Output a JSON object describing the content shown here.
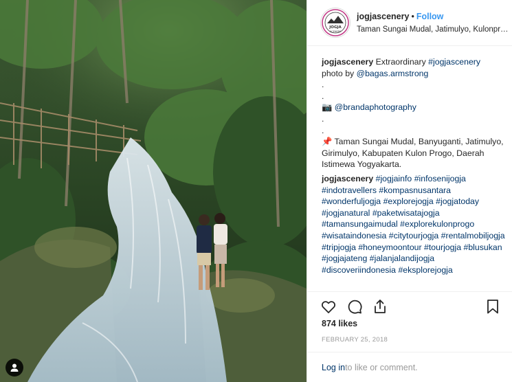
{
  "header": {
    "avatar_line1": "JOGJA",
    "avatar_line2": "SCENERY",
    "username": "jogjascenery",
    "separator": "•",
    "follow_label": "Follow",
    "location": "Taman Sungai Mudal, Jatimulyo, Kulonprogo"
  },
  "caption": {
    "username": "jogjascenery",
    "text_start": "Extraordinary ",
    "hashtag1": "#jogjascenery",
    "text_photo_by": "photo by ",
    "photo_mention": "@bagas.armstrong",
    "dot1": ".",
    "dot2": ".",
    "camera_icon": "📷",
    "camera_mention": "@brandaphotography",
    "dot3": ".",
    "dot4": ".",
    "pin_icon": "📌",
    "address": "Taman Sungai Mudal, Banyuganti, Jatimulyo, Girimulyo, Kabupaten Kulon Progo, Daerah Istimewa Yogyakarta."
  },
  "comment": {
    "username": "jogjascenery",
    "hashtags": [
      "#jogjainfo",
      "#infosenijogja",
      "#indotravellers",
      "#kompasnusantara",
      "#wonderfuljogja",
      "#explorejogja",
      "#jogjatoday",
      "#jogjanatural",
      "#paketwisatajogja",
      "#tamansungaimudal",
      "#explorekulonprogo",
      "#wisataindonesia",
      "#citytourjogja",
      "#rentalmobiljogja",
      "#tripjogja",
      "#honeymoontour",
      "#tourjogja",
      "#blusukan",
      "#jogjajateng",
      "#jalanjalandijogja",
      "#discoveriindonesia",
      "#eksplorejogja"
    ]
  },
  "actions": {
    "icons": [
      "heart-icon",
      "comment-icon",
      "share-icon",
      "bookmark-icon"
    ]
  },
  "likes_text": "874 likes",
  "date_text": "FEBRUARY 25, 2018",
  "footer": {
    "login_label": "Log in",
    "rest_text": " to like or comment."
  },
  "colors": {
    "link": "#003569",
    "follow": "#3897f0",
    "muted": "#999999",
    "text": "#262626"
  }
}
